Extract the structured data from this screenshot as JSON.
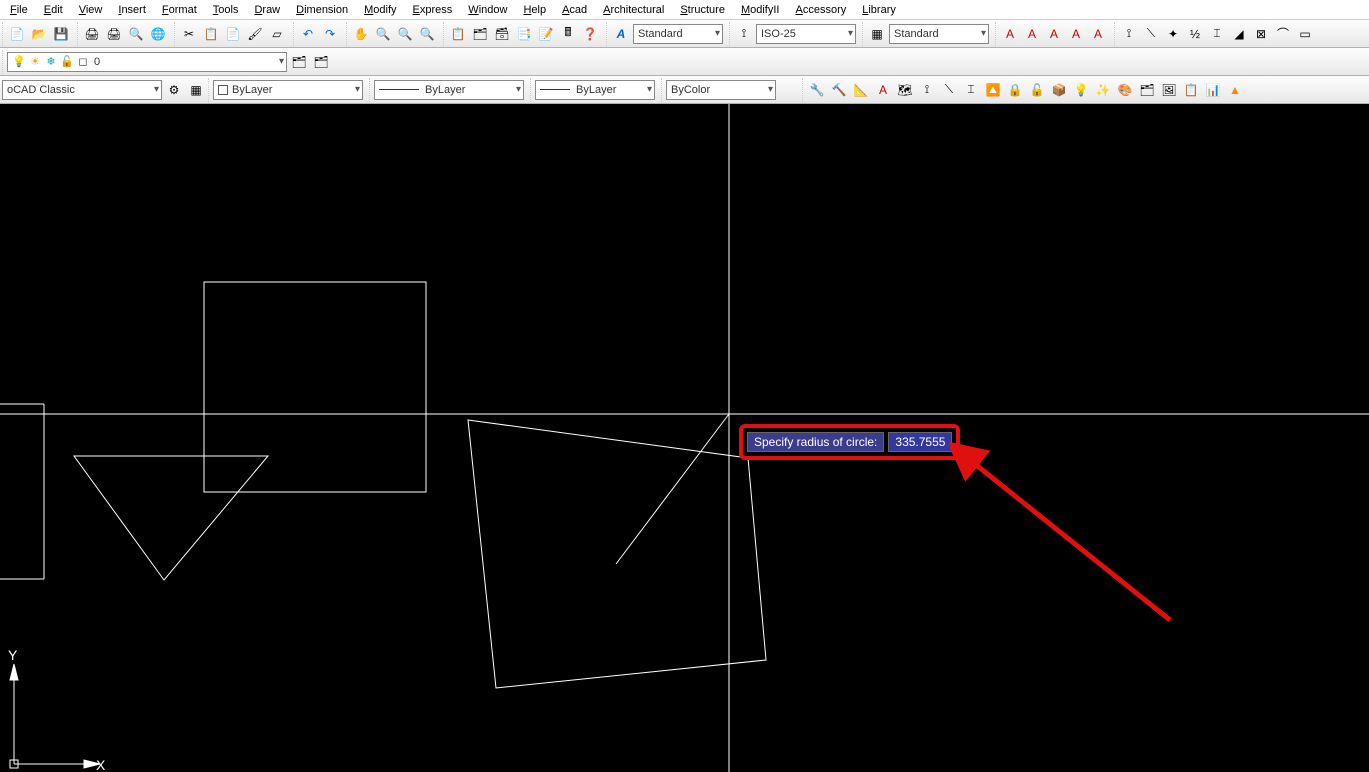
{
  "menu": {
    "items": [
      {
        "label": "File",
        "mn": "F",
        "rest": "ile"
      },
      {
        "label": "Edit",
        "mn": "E",
        "rest": "dit"
      },
      {
        "label": "View",
        "mn": "V",
        "rest": "iew"
      },
      {
        "label": "Insert",
        "mn": "I",
        "rest": "nsert"
      },
      {
        "label": "Format",
        "mn": "F",
        "rest": "ormat"
      },
      {
        "label": "Tools",
        "mn": "T",
        "rest": "ools"
      },
      {
        "label": "Draw",
        "mn": "D",
        "rest": "raw"
      },
      {
        "label": "Dimension",
        "mn": "D",
        "rest": "imension"
      },
      {
        "label": "Modify",
        "mn": "M",
        "rest": "odify"
      },
      {
        "label": "Express",
        "mn": "E",
        "rest": "xpress"
      },
      {
        "label": "Window",
        "mn": "W",
        "rest": "indow"
      },
      {
        "label": "Help",
        "mn": "H",
        "rest": "elp"
      },
      {
        "label": "Acad",
        "mn": "A",
        "rest": "cad"
      },
      {
        "label": "Architectural",
        "mn": "A",
        "rest": "rchitectural"
      },
      {
        "label": "Structure",
        "mn": "S",
        "rest": "tructure"
      },
      {
        "label": "ModifyII",
        "mn": "M",
        "rest": "odifyII"
      },
      {
        "label": "Accessory",
        "mn": "A",
        "rest": "ccessory"
      },
      {
        "label": "Library",
        "mn": "L",
        "rest": "ibrary"
      }
    ]
  },
  "toolbar1": {
    "text_style": "Standard",
    "dim_style": "ISO-25",
    "table_style": "Standard"
  },
  "layer_row": {
    "layer_value": "0"
  },
  "props_row": {
    "workspace": "oCAD Classic",
    "color": "ByLayer",
    "linetype": "ByLayer",
    "lineweight": "ByLayer",
    "plotstyle": "ByColor"
  },
  "dynamic_input": {
    "prompt": "Specify radius of circle:",
    "value": "335.7555"
  },
  "axes": {
    "y": "Y",
    "x": "X"
  },
  "icons": {
    "new": "📄",
    "open": "📂",
    "save": "💾",
    "print": "🖨",
    "plot": "🖨",
    "preview": "🔍",
    "publish": "🌐",
    "cut": "✂",
    "copy": "📋",
    "paste": "📄",
    "match": "🖌",
    "eraser": "▱",
    "undo": "↶",
    "redo": "↷",
    "pan": "✋",
    "zoom": "🔍",
    "zoomwin": "🔍",
    "props": "📋",
    "dc": "🗂",
    "tp": "🗃",
    "ssm": "📑",
    "markup": "📝",
    "qcalc": "🖩",
    "help": "❓",
    "textstyle": "A",
    "dimstyle": "⟟",
    "tablestyle": "▦",
    "a1": "A",
    "a2": "A",
    "a3": "A",
    "a4": "A",
    "a5": "A",
    "d1": "⟟",
    "d2": "⟍",
    "d3": "✦",
    "d4": "½",
    "d5": "⌶",
    "d6": "◢",
    "d7": "⊠",
    "d8": "⌒",
    "d9": "▭",
    "bulb": "💡",
    "sun": "☀",
    "freeze": "❄",
    "lock": "🔓",
    "square": "◻",
    "layprop": "🗂",
    "layiso": "🗂",
    "gear": "⚙",
    "toolpal": "▦"
  }
}
